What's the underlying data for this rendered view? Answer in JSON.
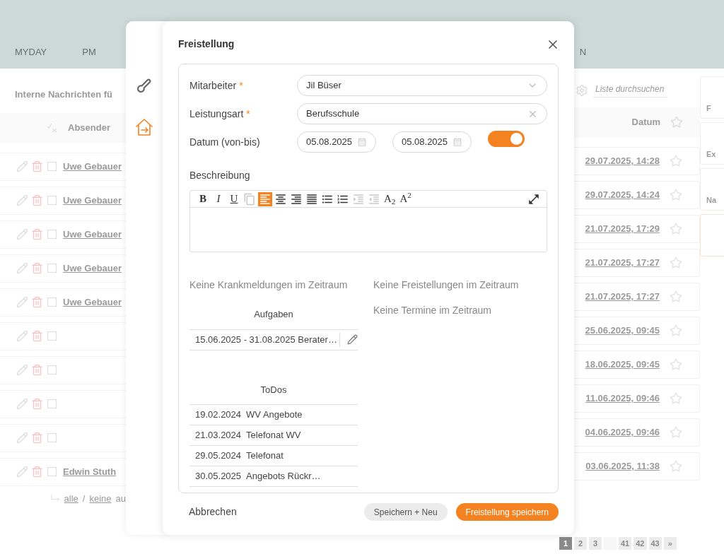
{
  "nav": [
    {
      "label": "MYDAY"
    },
    {
      "label": "PM"
    },
    {
      "label": "N"
    }
  ],
  "list": {
    "title": "Interne Nachrichten fü",
    "search": {
      "placeholder": "Liste durchsuchen"
    },
    "columns": [
      "Absender",
      "Datum"
    ],
    "rows": [
      {
        "sender": "Uwe Gebauer",
        "date": "29.07.2025, 14:28",
        "checked": false,
        "starred": false
      },
      {
        "sender": "Uwe Gebauer",
        "date": "29.07.2025, 14:24",
        "checked": false,
        "starred": false
      },
      {
        "sender": "Uwe Gebauer",
        "date": "21.07.2025, 17:29",
        "checked": false,
        "starred": false
      },
      {
        "sender": "Uwe Gebauer",
        "date": "21.07.2025, 17:27",
        "checked": false,
        "starred": false
      },
      {
        "sender": "Uwe Gebauer",
        "date": "21.07.2025, 17:27",
        "checked": false,
        "starred": false
      },
      {
        "sender": "",
        "date": "25.06.2025, 09:45",
        "checked": false,
        "starred": false
      },
      {
        "sender": "",
        "date": "18.06.2025, 09:45",
        "checked": false,
        "starred": false
      },
      {
        "sender": "",
        "date": "11.06.2025, 09:46",
        "checked": false,
        "starred": false
      },
      {
        "sender": "",
        "date": "04.06.2025, 09:46",
        "checked": false,
        "starred": false
      },
      {
        "sender": "Edwin Stuth",
        "date": "03.06.2025, 11:38",
        "checked": false,
        "starred": false
      }
    ],
    "select_links": [
      "alle",
      "/",
      "keine",
      "au"
    ],
    "pages": [
      {
        "label": "1",
        "selected": true
      },
      {
        "label": "2",
        "selected": false
      },
      {
        "label": "3",
        "selected": false
      },
      {
        "selected": false
      },
      {
        "label": "41",
        "selected": false
      },
      {
        "label": "42",
        "selected": false
      },
      {
        "label": "43",
        "selected": false
      },
      {
        "label": "»",
        "selected": false
      }
    ]
  },
  "tiles": [
    {
      "label": "F"
    },
    {
      "label": "Ex"
    },
    {
      "label": "Na"
    },
    {
      "kind": "accent"
    }
  ],
  "side_tabs": [
    {
      "kind": "sick",
      "selected": false
    },
    {
      "kind": "leave",
      "selected": true
    }
  ],
  "dialog": {
    "title": "Freistellung",
    "employee": {
      "label": "Mitarbeiter",
      "required_mark": "*",
      "value": "Jil Büser"
    },
    "type": {
      "label": "Leistungsart",
      "required_mark": "*",
      "value": "Berufsschule"
    },
    "dates": {
      "label": "Datum (von-bis)",
      "from": "05.08.2025",
      "to": "05.08.2025",
      "toggle_on": true
    },
    "description": {
      "label": "Beschreibung",
      "toolbar": [
        {
          "kind": "bold",
          "label": "B",
          "selected": false,
          "disabled": false
        },
        {
          "kind": "italic",
          "label": "I",
          "selected": false,
          "disabled": false
        },
        {
          "kind": "underline",
          "label": "U",
          "selected": false,
          "disabled": false
        },
        {
          "kind": "copy",
          "selected": false,
          "disabled": true
        },
        {
          "kind": "align-left",
          "selected": true,
          "disabled": false
        },
        {
          "kind": "align-center",
          "selected": false,
          "disabled": false
        },
        {
          "kind": "align-right",
          "selected": false,
          "disabled": false
        },
        {
          "kind": "align-justify",
          "selected": false,
          "disabled": false
        },
        {
          "kind": "bullets",
          "selected": false,
          "disabled": false
        },
        {
          "kind": "numbers",
          "selected": false,
          "disabled": false
        },
        {
          "kind": "indent",
          "selected": false,
          "disabled": true
        },
        {
          "kind": "outdent",
          "selected": false,
          "disabled": true
        },
        {
          "kind": "subscript",
          "label": "A$_{2}$",
          "selected": false,
          "disabled": false
        },
        {
          "kind": "superscript",
          "label": "A$^{2}$",
          "selected": false,
          "disabled": false
        },
        {
          "kind": "fullscreen",
          "selected": false,
          "disabled": false
        }
      ]
    },
    "sick_notes": "Keine Krankmeldungen im Zeitraum",
    "leaves": "Keine Freistellungen im Zeitraum",
    "appointments": "Keine Termine im Zeitraum",
    "tasks": {
      "title": "Aufgaben",
      "rows": [
        "15.06.2025 - 31.08.2025 Berater…"
      ]
    },
    "todos": {
      "title": "ToDos",
      "rows": [
        {
          "date": "19.02.2024",
          "text": "WV Angebote"
        },
        {
          "date": "21.03.2024",
          "text": "Telefonat WV"
        },
        {
          "date": "29.05.2024",
          "text": "Telefonat"
        },
        {
          "date": "30.05.2025",
          "text": "Angebots Rückr…"
        }
      ]
    },
    "cancel": "Abbrechen",
    "save_new": "Speichern + Neu",
    "save": "Freistellung speichern"
  }
}
